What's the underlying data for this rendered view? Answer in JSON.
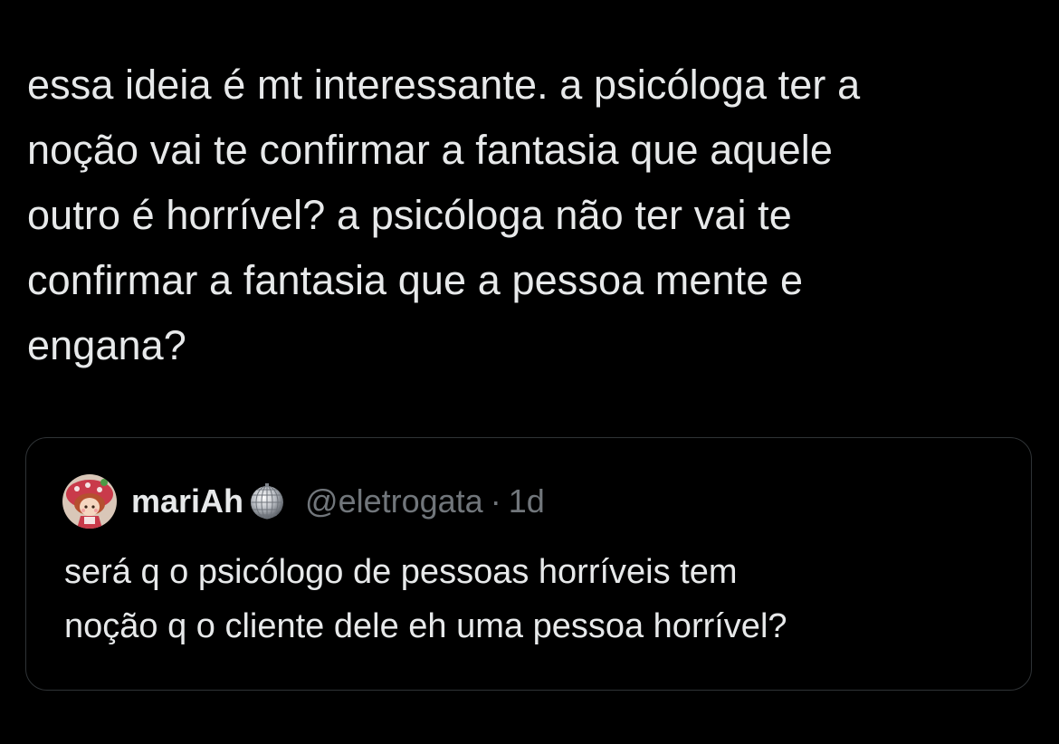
{
  "tweet": {
    "text": "essa ideia é mt interessante. a psicóloga ter a\nnoção vai te confirmar a fantasia que aquele\noutro é horrível? a psicóloga não ter vai te\nconfirmar a fantasia que a pessoa mente e\nengana?"
  },
  "quoted_tweet": {
    "author_name": "mariAh",
    "author_emoji": "disco-ball-icon",
    "handle": "@eletrogata",
    "separator": "·",
    "time": "1d",
    "text": "será q o psicólogo de pessoas horríveis tem\nnoção q o cliente dele eh uma pessoa horrível?"
  },
  "colors": {
    "background": "#000000",
    "primary_text": "#e7e9ea",
    "secondary_text": "#71767b",
    "card_border": "#2f3336"
  }
}
